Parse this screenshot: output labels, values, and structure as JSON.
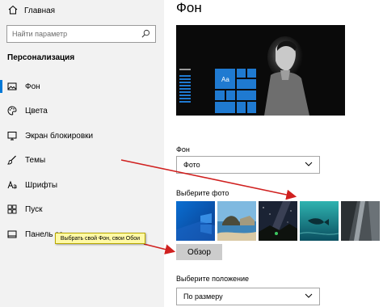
{
  "sidebar": {
    "home_label": "Главная",
    "search_placeholder": "Найти параметр",
    "section_title": "Персонализация",
    "items": [
      {
        "label": "Фон",
        "icon": "image-icon",
        "active": true
      },
      {
        "label": "Цвета",
        "icon": "palette-icon",
        "active": false
      },
      {
        "label": "Экран блокировки",
        "icon": "lock-screen-icon",
        "active": false
      },
      {
        "label": "Темы",
        "icon": "brush-icon",
        "active": false
      },
      {
        "label": "Шрифты",
        "icon": "font-icon",
        "active": false
      },
      {
        "label": "Пуск",
        "icon": "start-icon",
        "active": false
      },
      {
        "label": "Панель за",
        "icon": "taskbar-icon",
        "active": false
      }
    ]
  },
  "main": {
    "title": "Фон",
    "preview_tile_label": "Aa",
    "background_label": "Фон",
    "background_value": "Фото",
    "choose_photo_label": "Выберите фото",
    "browse_button": "Обзор",
    "position_label": "Выберите положение",
    "position_value": "По размеру"
  },
  "annotation": {
    "tooltip_text": "Выбрать свой Фон, свои Обои",
    "arrow_color": "#d0201f"
  },
  "colors": {
    "accent": "#0078d7",
    "sidebar_bg": "#f2f2f2",
    "tile_blue": "#1f7ad1"
  }
}
